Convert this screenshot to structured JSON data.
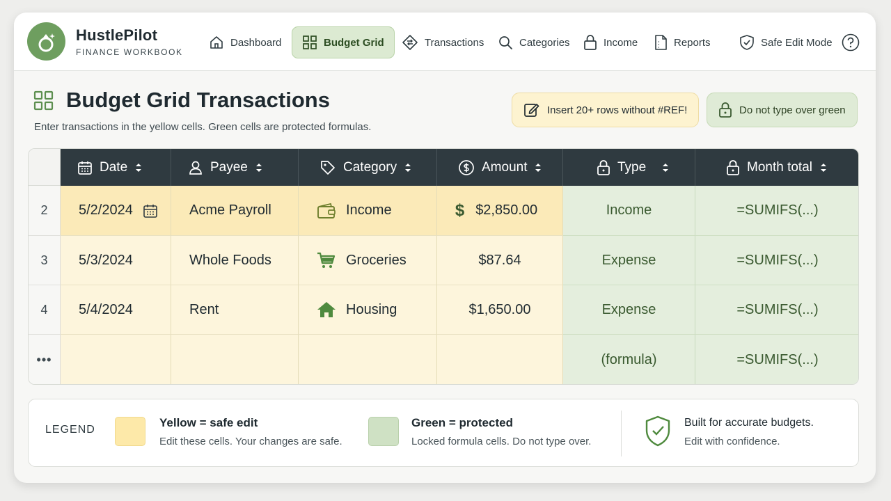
{
  "brand": {
    "name": "HustlePilot",
    "subtitle": "FINANCE WORKBOOK"
  },
  "nav": [
    {
      "label": "Dashboard",
      "icon": "home-icon",
      "active": false
    },
    {
      "label": "Budget Grid",
      "icon": "grid-icon",
      "active": true
    },
    {
      "label": "Transactions",
      "icon": "transactions-icon",
      "active": false
    },
    {
      "label": "Categories",
      "icon": "search-icon",
      "active": false
    },
    {
      "label": "Income",
      "icon": "lock-icon",
      "active": false
    },
    {
      "label": "Reports",
      "icon": "report-icon",
      "active": false
    },
    {
      "label": "Safe Edit Mode",
      "icon": "shield-check-icon",
      "active": false
    }
  ],
  "page": {
    "title": "Budget Grid Transactions",
    "subtitle": "Enter transactions in the yellow cells. Green cells are protected formulas."
  },
  "chips": {
    "insert": "Insert 20+ rows without #REF!",
    "protect": "Do not type over green"
  },
  "table": {
    "columns": [
      "Date",
      "Payee",
      "Category",
      "Amount",
      "Type",
      "Month total"
    ],
    "rows": [
      {
        "num": "2",
        "date": "5/2/2024",
        "payee": "Acme Payroll",
        "category": "Income",
        "amount": "$2,850.00",
        "type": "Income",
        "total": "=SUMIFS(...)"
      },
      {
        "num": "3",
        "date": "5/3/2024",
        "payee": "Whole Foods",
        "category": "Groceries",
        "amount": "$87.64",
        "type": "Expense",
        "total": "=SUMIFS(...)"
      },
      {
        "num": "4",
        "date": "5/4/2024",
        "payee": "Rent",
        "category": "Housing",
        "amount": "$1,650.00",
        "type": "Expense",
        "total": "=SUMIFS(...)"
      },
      {
        "num": "•••",
        "date": "",
        "payee": "",
        "category": "",
        "amount": "",
        "type": "(formula)",
        "total": "=SUMIFS(...)"
      }
    ]
  },
  "legend": {
    "label": "LEGEND",
    "yellow_title": "Yellow = safe edit",
    "yellow_text": "Edit these cells. Your changes are safe.",
    "green_title": "Green = protected",
    "green_text": "Locked formula cells. Do not type over.",
    "right_title": "Built for accurate budgets.",
    "right_text": "Edit with confidence."
  },
  "colors": {
    "brand_green": "#6e9e5f",
    "header_dark": "#2f3a40",
    "safe_yellow": "#fdf5dc",
    "protected_green": "#e4eedd"
  }
}
